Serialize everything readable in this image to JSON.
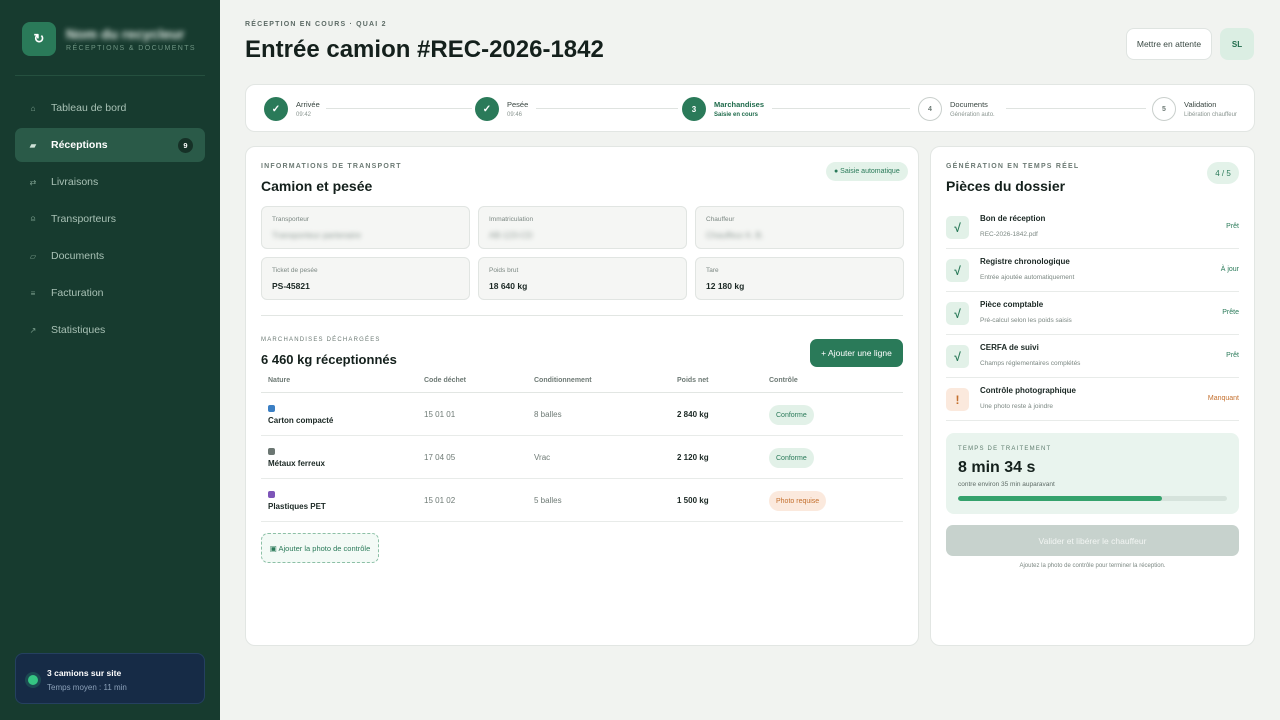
{
  "sidebar": {
    "brand": {
      "logo": "↻",
      "name": "Nom du recycleur",
      "sub": "RÉCEPTIONS & DOCUMENTS"
    },
    "items": [
      {
        "label": "Tableau de bord",
        "icon": "⌂",
        "icon_name": "home-icon"
      },
      {
        "label": "Réceptions",
        "icon": "▰",
        "icon_name": "truck-icon",
        "badge": "9",
        "active": true
      },
      {
        "label": "Livraisons",
        "icon": "⇄",
        "icon_name": "exchange-icon"
      },
      {
        "label": "Transporteurs",
        "icon": "⍝",
        "icon_name": "user-icon"
      },
      {
        "label": "Documents",
        "icon": "▱",
        "icon_name": "document-icon"
      },
      {
        "label": "Facturation",
        "icon": "≡",
        "icon_name": "invoice-icon"
      },
      {
        "label": "Statistiques",
        "icon": "↗",
        "icon_name": "stats-icon"
      }
    ],
    "site": {
      "title": "3 camions sur site",
      "sub": "Temps moyen : 11 min"
    }
  },
  "header": {
    "eyebrow": "RÉCEPTION EN COURS · QUAI 2",
    "title": "Entrée camion #REC-2026-1842",
    "wait_button": "Mettre en attente",
    "avatar": "SL"
  },
  "steps": [
    {
      "num": "✓",
      "label": "Arrivée",
      "sub": "09:42",
      "state": "done"
    },
    {
      "num": "✓",
      "label": "Pesée",
      "sub": "09:46",
      "state": "done"
    },
    {
      "num": "3",
      "label": "Marchandises",
      "sub": "Saisie en cours",
      "state": "current"
    },
    {
      "num": "4",
      "label": "Documents",
      "sub": "Génération auto.",
      "state": "todo"
    },
    {
      "num": "5",
      "label": "Validation",
      "sub": "Libération chauffeur",
      "state": "todo"
    }
  ],
  "transport": {
    "eyebrow": "INFORMATIONS DE TRANSPORT",
    "title": "Camion et pesée",
    "auto_pill": "● Saisie automatique",
    "fields": [
      {
        "label": "Transporteur",
        "value": "Transporteur partenaire",
        "blurred": true
      },
      {
        "label": "Immatriculation",
        "value": "AB-123-CD",
        "blurred": true
      },
      {
        "label": "Chauffeur",
        "value": "Chauffeur A. B.",
        "blurred": true
      },
      {
        "label": "Ticket de pesée",
        "value": "PS-45821"
      },
      {
        "label": "Poids brut",
        "value": "18 640 kg"
      },
      {
        "label": "Tare",
        "value": "12 180 kg"
      }
    ]
  },
  "goods": {
    "eyebrow": "MARCHANDISES DÉCHARGÉES",
    "title": "6 460 kg réceptionnés",
    "add_button": "+ Ajouter une ligne",
    "columns": [
      "Nature",
      "Code déchet",
      "Conditionnement",
      "Poids net",
      "Contrôle"
    ],
    "rows": [
      {
        "nature": "Carton compacté",
        "color": "#3b7fc4",
        "code": "15 01 01",
        "cond": "8 balles",
        "poids": "2 840 kg",
        "status": "Conforme",
        "status_type": "ok"
      },
      {
        "nature": "Métaux ferreux",
        "color": "#6b7672",
        "code": "17 04 05",
        "cond": "Vrac",
        "poids": "2 120 kg",
        "status": "Conforme",
        "status_type": "ok"
      },
      {
        "nature": "Plastiques PET",
        "color": "#7d55b8",
        "code": "15 01 02",
        "cond": "5 balles",
        "poids": "1 500 kg",
        "status": "Photo requise",
        "status_type": "warn"
      }
    ],
    "photo_button": "▣ Ajouter la photo de contrôle"
  },
  "dossier": {
    "eyebrow": "GÉNÉRATION EN TEMPS RÉEL",
    "title": "Pièces du dossier",
    "count": "4 / 5",
    "docs": [
      {
        "title": "Bon de réception",
        "sub": "REC-2026-1842.pdf",
        "status": "Prêt",
        "type": "ok",
        "icon": "√"
      },
      {
        "title": "Registre chronologique",
        "sub": "Entrée ajoutée automatiquement",
        "status": "À jour",
        "type": "ok",
        "icon": "√"
      },
      {
        "title": "Pièce comptable",
        "sub": "Pré-calcul selon les poids saisis",
        "status": "Prête",
        "type": "ok",
        "icon": "√"
      },
      {
        "title": "CERFA de suivi",
        "sub": "Champs réglementaires complétés",
        "status": "Prêt",
        "type": "ok",
        "icon": "√"
      },
      {
        "title": "Contrôle photographique",
        "sub": "Une photo reste à joindre",
        "status": "Manquant",
        "type": "warn",
        "icon": "!"
      }
    ],
    "timer": {
      "eyebrow": "TEMPS DE TRAITEMENT",
      "value": "8 min 34 s",
      "sub": "contre environ 35 min auparavant",
      "progress": 0.76
    },
    "validate_button": "Valider et libérer le chauffeur",
    "hint": "Ajoutez la photo de contrôle pour terminer la réception."
  },
  "colors": {
    "accent": "#2a7a59",
    "sidebar": "#173b2f",
    "warn": "#c4702e"
  }
}
